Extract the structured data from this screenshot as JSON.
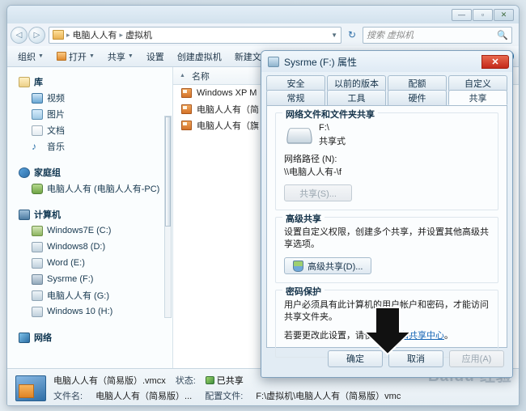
{
  "explorer": {
    "window_controls": {
      "minimize": "—",
      "maximize": "▫",
      "close": "✕"
    },
    "nav": {
      "back": "◁",
      "forward": "▷",
      "dropdown": "▼",
      "refresh": "↻"
    },
    "breadcrumb": {
      "sep": "▸",
      "items": [
        "电脑人人有",
        "虚拟机"
      ]
    },
    "search": {
      "placeholder": "搜索 虚拟机",
      "icon": "search-icon"
    },
    "toolbar": {
      "organize": "组织",
      "open": "打开",
      "share": "共享",
      "settings": "设置",
      "create_vm": "创建虚拟机",
      "new_folder": "新建文件夹",
      "caret": "▼",
      "help": "?"
    },
    "sidebar": {
      "groups": [
        {
          "head": "库",
          "items": [
            "视频",
            "图片",
            "文档",
            "音乐"
          ]
        },
        {
          "head": "家庭组",
          "items": [
            "电脑人人有 (电脑人人有-PC)"
          ]
        },
        {
          "head": "计算机",
          "items": [
            "Windows7E (C:)",
            "Windows8 (D:)",
            "Word (E:)",
            "Sysrme (F:)",
            "电脑人人有 (G:)",
            "Windows 10 (H:)"
          ]
        },
        {
          "head": "网络",
          "items": []
        }
      ]
    },
    "list": {
      "column_header": "名称",
      "sort_caret": "▲",
      "files": [
        "Windows XP M",
        "电脑人人有（简",
        "电脑人人有（旗"
      ]
    },
    "status": {
      "filename_title": "电脑人人有（简易版）.vmcx",
      "state_label": "状态:",
      "state_value": "已共享",
      "file_label": "文件名:",
      "file_value": "电脑人人有（简易版）...",
      "config_label": "配置文件:",
      "config_value": "F:\\虚拟机\\电脑人人有（简易版）vmc",
      "watermark": "Baidu 经验"
    }
  },
  "dialog": {
    "title": "Sysrme (F:) 属性",
    "close": "✕",
    "tabs_row1": [
      "安全",
      "以前的版本",
      "配额",
      "自定义"
    ],
    "tabs_row2": [
      "常规",
      "工具",
      "硬件",
      "共享"
    ],
    "active_tab": "共享",
    "network_share": {
      "group_title": "网络文件和文件夹共享",
      "drive": "F:\\",
      "state": "共享式",
      "path_label": "网络路径 (N):",
      "path_value": "\\\\电脑人人有-\\f",
      "share_button": "共享(S)..."
    },
    "advanced": {
      "group_title": "高级共享",
      "description": "设置自定义权限，创建多个共享，并设置其他高级共享选项。",
      "button": "高级共享(D)..."
    },
    "password": {
      "group_title": "密码保护",
      "description": "用户必须具有此计算机的用户帐户和密码，才能访问共享文件夹。",
      "change_prefix": "若要更改此设置，请使用",
      "change_link": "网络和共享中心",
      "change_suffix": "。"
    },
    "buttons": {
      "ok": "确定",
      "cancel": "取消",
      "apply": "应用(A)"
    }
  }
}
